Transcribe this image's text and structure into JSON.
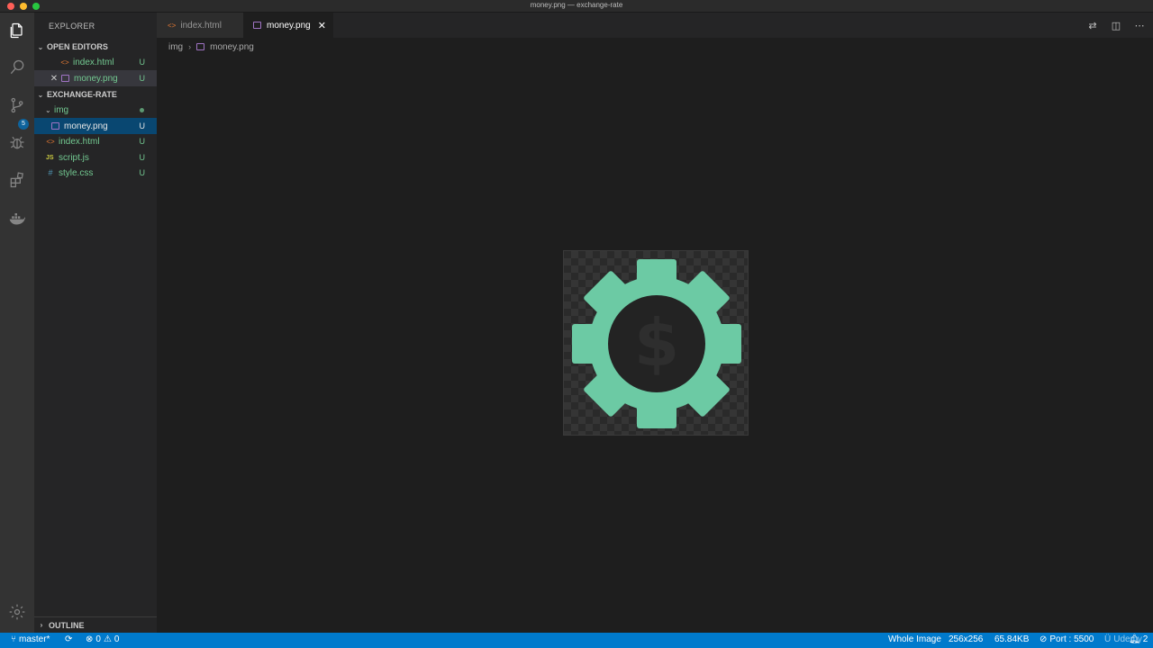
{
  "window": {
    "title": "money.png — exchange-rate"
  },
  "activity_bar": {
    "icons": [
      "files-icon",
      "search-icon",
      "source-control-icon",
      "debug-icon",
      "extensions-icon",
      "docker-icon",
      "settings-gear-icon"
    ],
    "source_control_badge": "5"
  },
  "sidebar": {
    "title": "EXPLORER",
    "open_editors": {
      "label": "OPEN EDITORS",
      "items": [
        {
          "name": "index.html",
          "status": "U"
        },
        {
          "name": "money.png",
          "status": "U"
        }
      ]
    },
    "project": {
      "label": "EXCHANGE-RATE",
      "folder": "img",
      "items": [
        {
          "name": "money.png",
          "status": "U"
        },
        {
          "name": "index.html",
          "status": "U"
        },
        {
          "name": "script.js",
          "status": "U",
          "icon_text": "JS"
        },
        {
          "name": "style.css",
          "status": "U",
          "icon_text": "#"
        }
      ]
    },
    "outline_label": "OUTLINE"
  },
  "tabs": [
    {
      "label": "index.html",
      "active": false
    },
    {
      "label": "money.png",
      "active": true
    }
  ],
  "breadcrumb": {
    "folder": "img",
    "file": "money.png"
  },
  "image_preview": {
    "file": "money.png",
    "gear_color": "#6ccaa4",
    "symbol": "$"
  },
  "status_bar": {
    "branch": "master*",
    "errors": "0",
    "warnings": "0",
    "image_mode": "Whole Image",
    "dimensions": "256x256",
    "file_size": "65.84KB",
    "port": "Port : 5500",
    "notifications": "2",
    "watermark": "Udemy"
  },
  "colors": {
    "accent": "#007acc",
    "selection": "#094771",
    "untracked": "#73c991"
  }
}
